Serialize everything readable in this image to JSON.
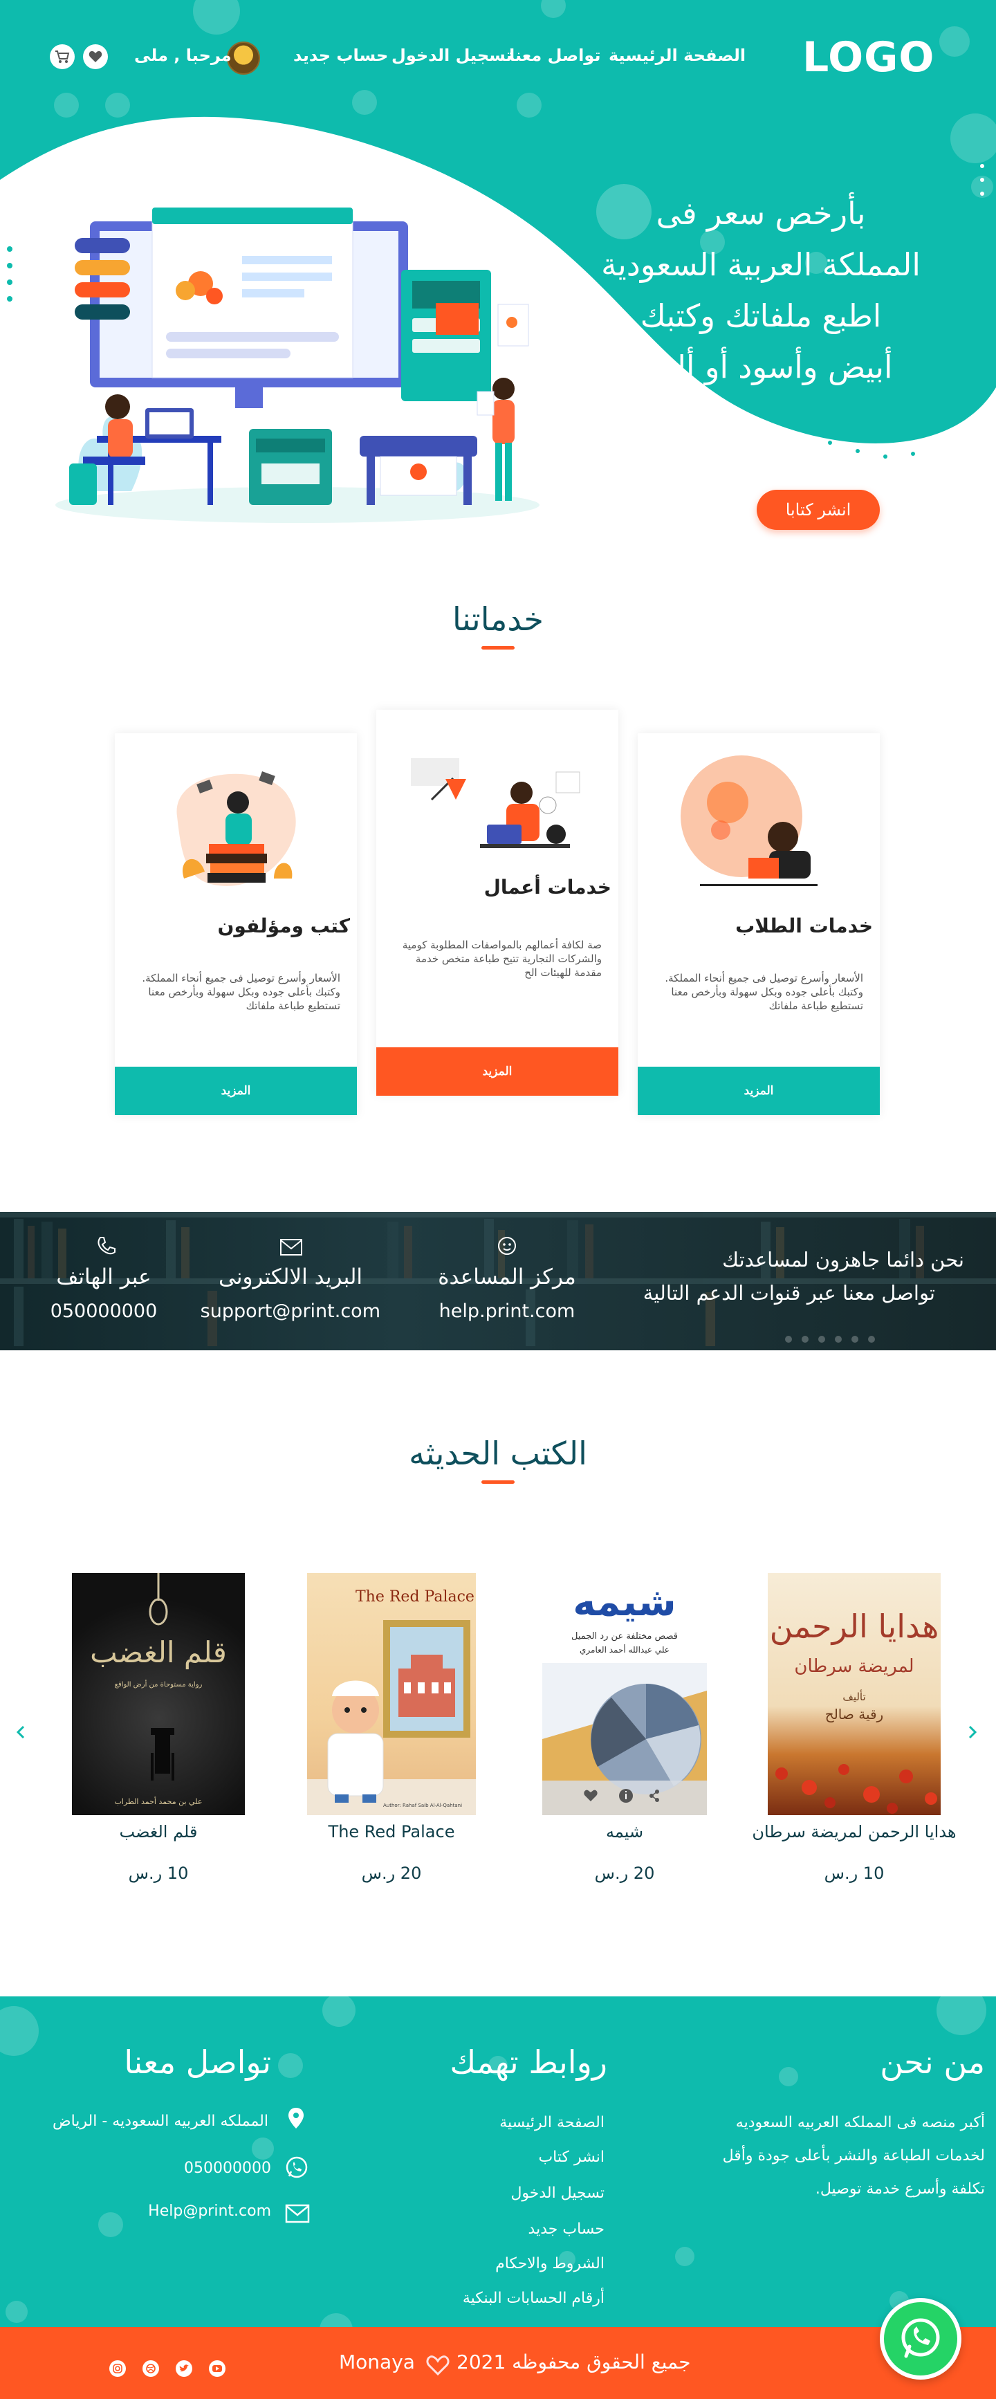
{
  "header": {
    "logo": "LOGO",
    "nav": [
      "الصفحة الرئيسية",
      "تواصل معنا",
      "تسجيل الدخول",
      "حساب جديد"
    ],
    "greeting": "مرحبا , ملى"
  },
  "hero": {
    "title_lines": [
      "بأرخص سعر فى",
      "المملكة العربية السعودية",
      "اطبع ملفاتك وكتبك",
      "أبيض وأسود أو ألوان"
    ],
    "cta": "انشر كتابا"
  },
  "services": {
    "title": "خدماتنا",
    "cards": [
      {
        "title": "خدمات الطلاب",
        "desc": "الأسعار وأسرع توصيل فى جميع أنحاء المملكة. وكتبك بأعلى جوده وبكل سهولة وبأرخص معنا تستطيع طباعة ملفاتك",
        "button": "المزيد"
      },
      {
        "title": "خدمات أعمال",
        "desc": "صة لكافة أعمالهم بالمواصفات المطلوبة كومية والشركات التجارية تتيح طباعة متخص خدمة مقدمة للهيئات الح",
        "button": "المزيد"
      },
      {
        "title": "كتب ومؤلفون",
        "desc": "الأسعار وأسرع توصيل فى جميع أنحاء المملكة. وكتبك بأعلى جوده وبكل سهولة وبأرخص معنا تستطيع طباعة ملفاتك",
        "button": "المزيد"
      }
    ]
  },
  "support": {
    "line1": "نحن دائما جاهزون لمساعدتك",
    "line2": "تواصل معنا عبر قنوات الدعم التالية",
    "channels": [
      {
        "label": "مركز المساعدة",
        "value": "help.print.com"
      },
      {
        "label": "البريد الالكترونى",
        "value": "support@print.com"
      },
      {
        "label": "عبر الهاتف",
        "value": "050000000"
      }
    ]
  },
  "books": {
    "title": "الكتب الحديثه",
    "items": [
      {
        "title": "هدايا الرحمن لمريضة سرطان",
        "price": "10 ر.س",
        "cover_heading": "هدايا الرحمن",
        "cover_sub": "لمريضة سرطان",
        "cover_author_label": "تأليف",
        "cover_author": "رقية صالح"
      },
      {
        "title": "شيمه",
        "price": "20 ر.س",
        "cover_heading": "شيمه",
        "cover_sub": "قصص مختلفة عن رد الجميل",
        "cover_author": "علي عبدالله أحمد العامري"
      },
      {
        "title": "The Red Palace",
        "price": "20 ر.س",
        "cover_heading": "The Red Palace",
        "cover_author": "Author: Rahaf Saib Al-Al-Qahtani"
      },
      {
        "title": "قلم الغضب",
        "price": "10 ر.س",
        "cover_heading": "قلم الغضب",
        "cover_sub": "رواية مستوحاة من أرض الواقع",
        "cover_author": "علي بن محمد أحمد الطراب"
      }
    ]
  },
  "footer": {
    "about": {
      "title": "من نحن",
      "lines": [
        "أكبر منصه فى المملكه العربيه السعوديه",
        "لخدمات الطباعة والنشر بأعلى جودة وأقل",
        "تكلفة وأسرع خدمة توصيل."
      ]
    },
    "links": {
      "title": "روابط تهمك",
      "items": [
        "الصفحة الرئيسية",
        "انشر كتاب",
        "تسجيل الدخول",
        "حساب جديد",
        "الشروط والاحكام",
        "أرقام الحسابات البنكية"
      ]
    },
    "contact": {
      "title": "تواصل معنا",
      "address": "المملكه العربيه السعوديه - الرياض",
      "phone": "050000000",
      "email": "Help@print.com"
    }
  },
  "copyright": {
    "text": "جميع الحقوق محفوظه 2021",
    "brand": "Monaya"
  },
  "colors": {
    "primary": "#0ebbad",
    "accent": "#ff5722",
    "dark": "#0e4f5c"
  },
  "icons": [
    "cart-icon",
    "heart-icon",
    "headset-icon",
    "mail-icon",
    "phone-icon",
    "location-icon",
    "whatsapp-icon",
    "instagram-icon",
    "dribbble-icon",
    "twitter-icon",
    "youtube-icon"
  ]
}
